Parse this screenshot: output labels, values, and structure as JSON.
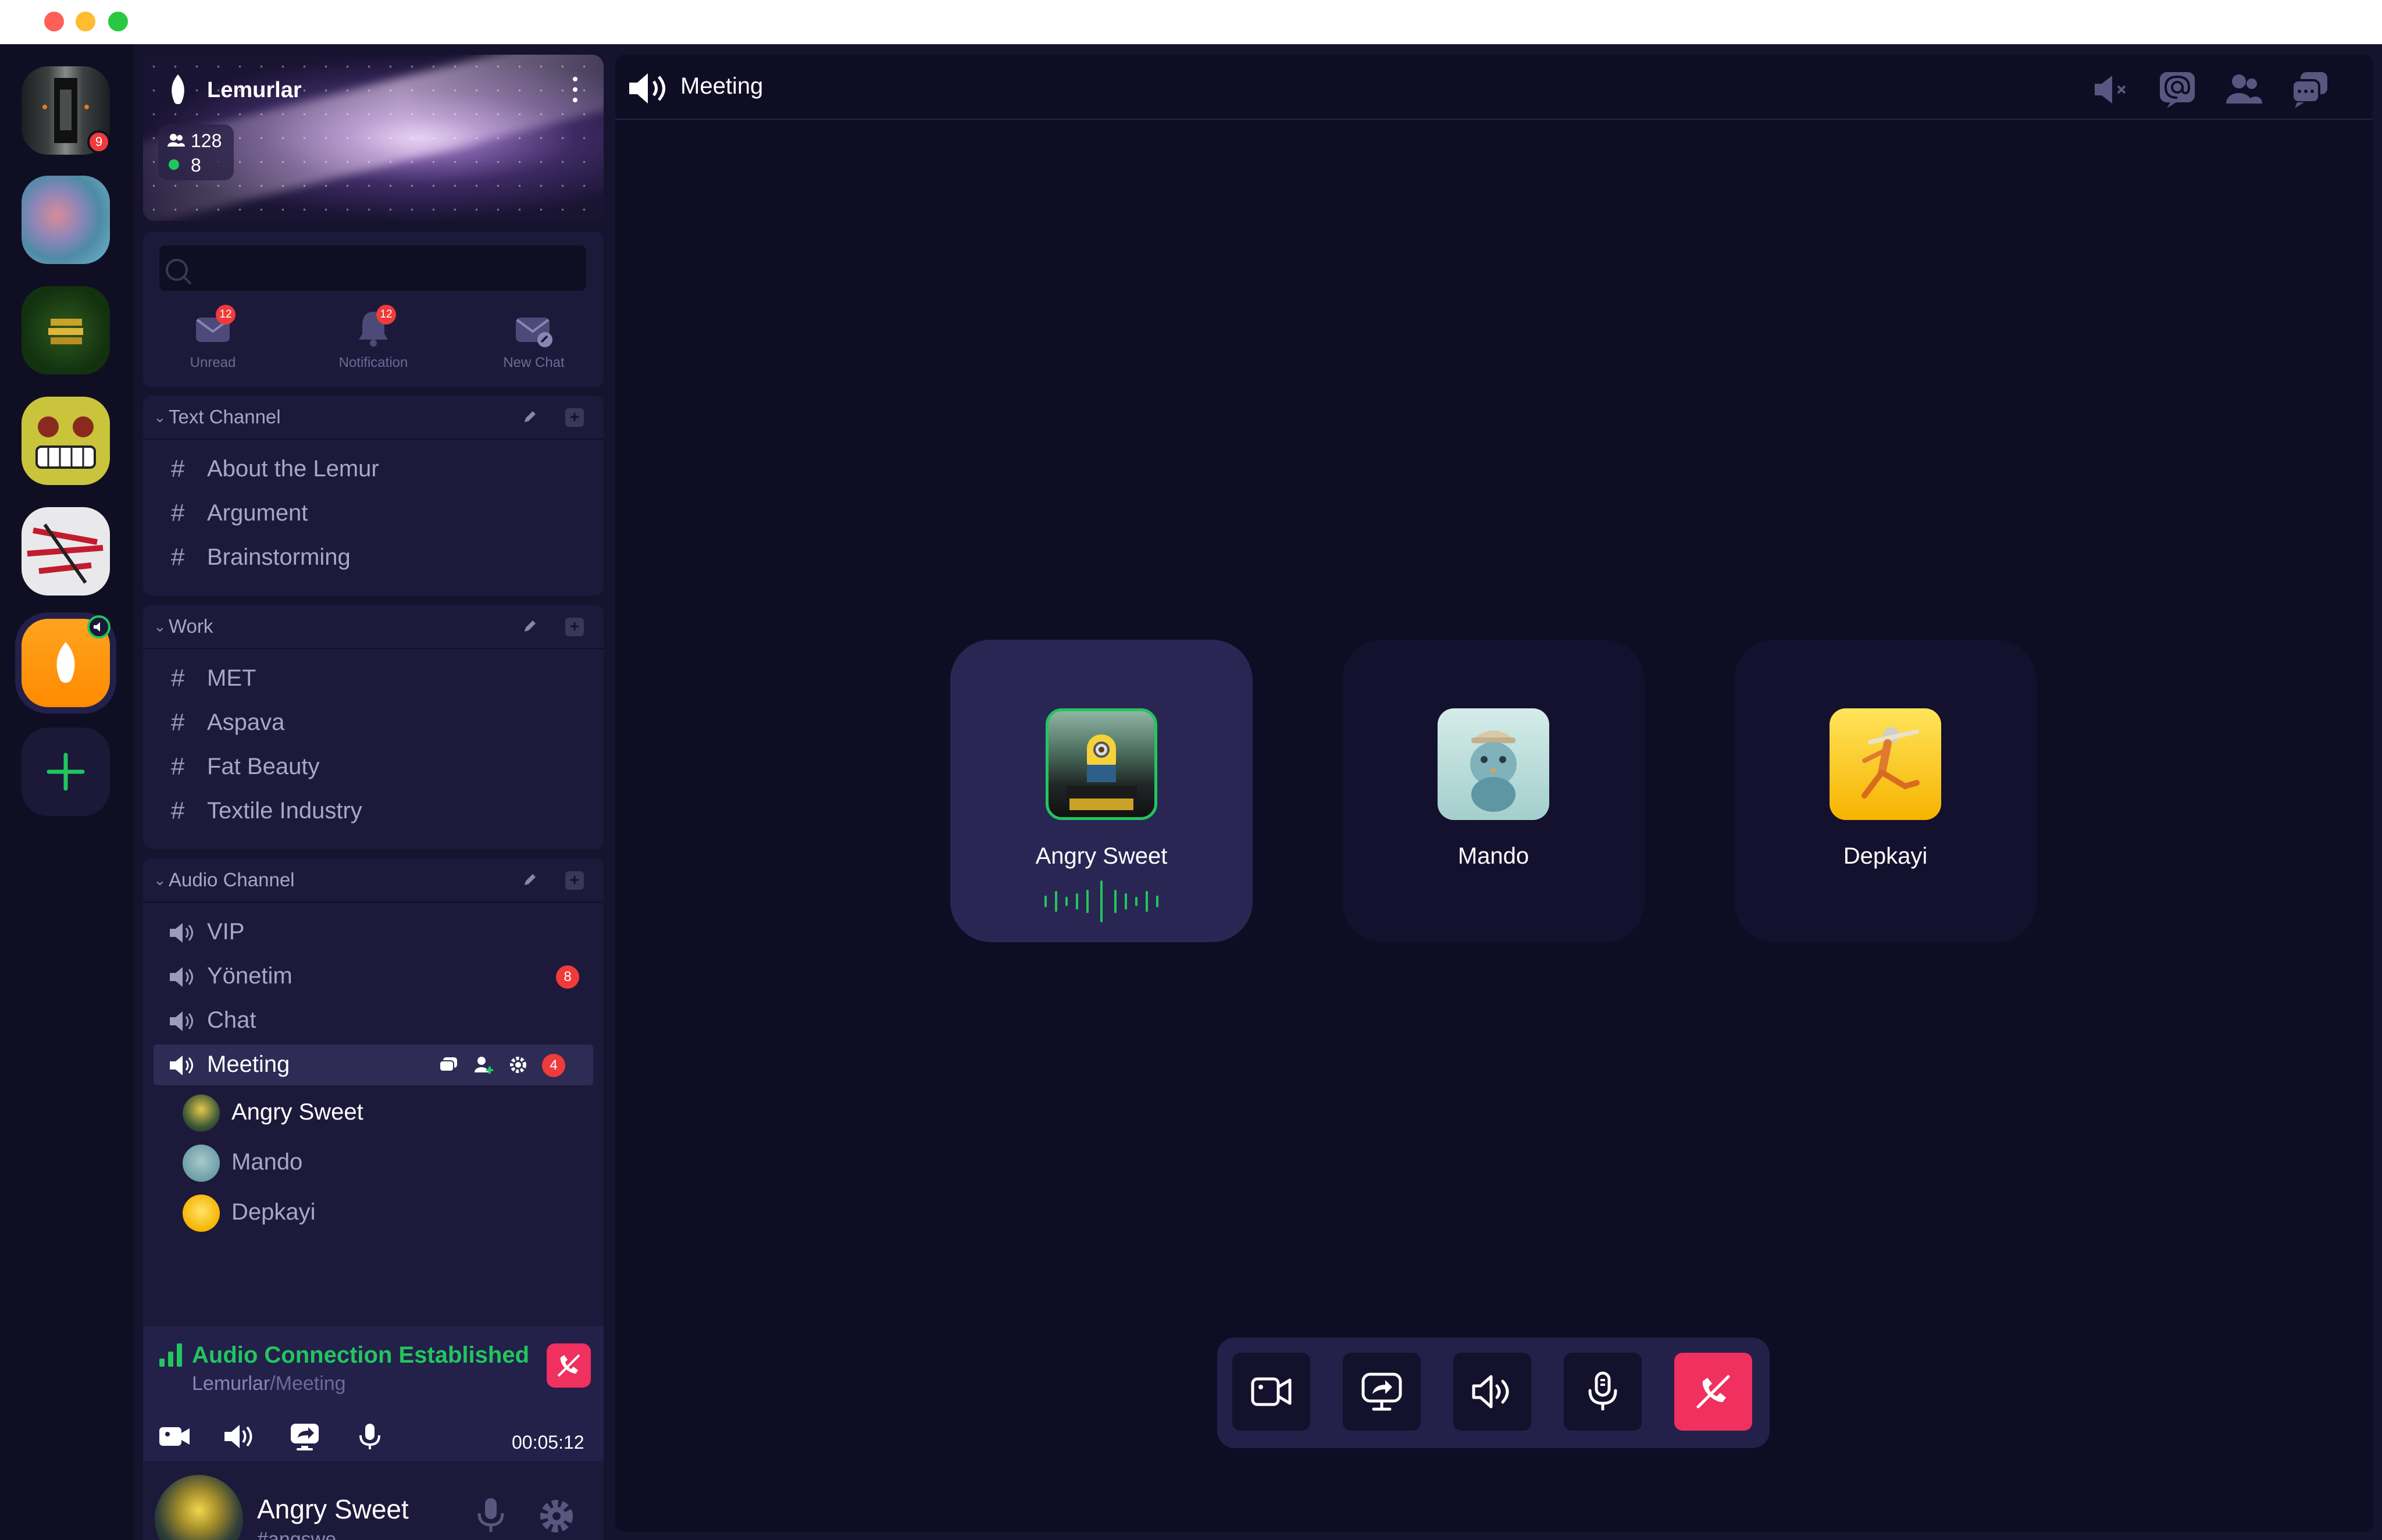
{
  "window": {
    "controls": [
      "close",
      "minimize",
      "maximize"
    ]
  },
  "servers": [
    {
      "name": "server-hallway",
      "badge": "9"
    },
    {
      "name": "server-gradient-orb",
      "badge": ""
    },
    {
      "name": "server-green-stack",
      "badge": ""
    },
    {
      "name": "server-yellow-face",
      "badge": ""
    },
    {
      "name": "server-red-lines",
      "badge": ""
    },
    {
      "name": "server-lemurlar",
      "badge": "",
      "active": true,
      "voice_indicator": true
    }
  ],
  "server": {
    "name": "Lemurlar",
    "members_total": "128",
    "members_online": "8"
  },
  "search": {
    "placeholder": ""
  },
  "quick_actions": {
    "unread": {
      "label": "Unread",
      "badge": "12"
    },
    "notification": {
      "label": "Notification",
      "badge": "12"
    },
    "new_chat": {
      "label": "New Chat"
    }
  },
  "sections": {
    "text": {
      "title": "Text Channel",
      "channels": [
        "About the Lemur",
        "Argument",
        "Brainstorming"
      ]
    },
    "work": {
      "title": "Work",
      "channels": [
        "MET",
        "Aspava",
        "Fat Beauty",
        "Textile Industry"
      ]
    },
    "audio": {
      "title": "Audio Channel",
      "channels": [
        {
          "label": "VIP",
          "badge": ""
        },
        {
          "label": "Yönetim",
          "badge": "8"
        },
        {
          "label": "Chat",
          "badge": ""
        },
        {
          "label": "Meeting",
          "badge": "4"
        }
      ],
      "members": [
        "Angry Sweet",
        "Mando",
        "Depkayi"
      ]
    }
  },
  "voice_status": {
    "title": "Audio Connection Established",
    "server": "Lemurlar",
    "separator": "/",
    "channel": "Meeting",
    "timer": "00:05:12"
  },
  "user": {
    "name": "Angry Sweet",
    "tag": "#angswe",
    "status": "online"
  },
  "main": {
    "title": "Meeting",
    "participants": [
      {
        "name": "Angry Sweet",
        "speaking": true
      },
      {
        "name": "Mando",
        "speaking": false
      },
      {
        "name": "Depkayi",
        "speaking": false
      }
    ]
  },
  "colors": {
    "accent_green": "#22c55e",
    "danger": "#f0305f",
    "badge_red": "#ef3b3b",
    "bg_main": "#0f0d24",
    "bg_panel": "#1c193a"
  }
}
